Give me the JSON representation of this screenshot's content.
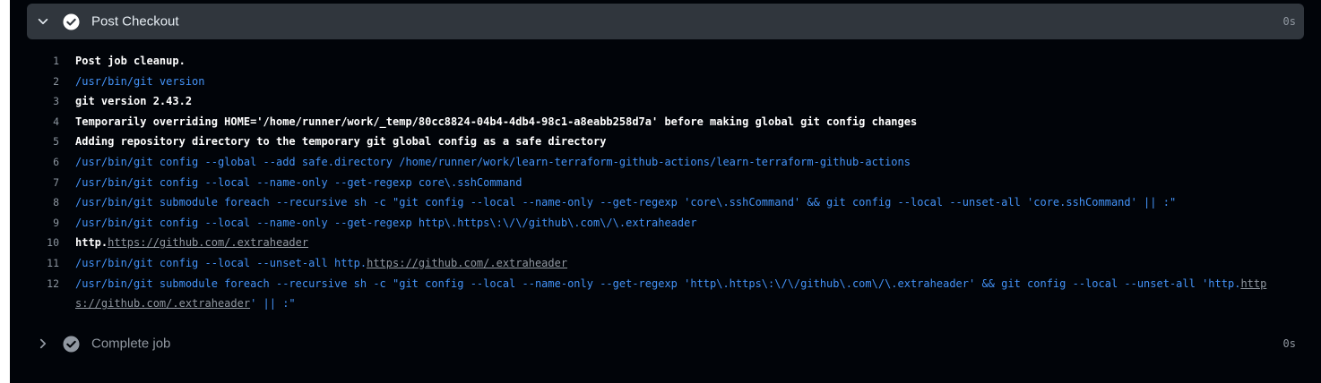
{
  "steps": [
    {
      "title": "Post Checkout",
      "duration": "0s",
      "expanded": true,
      "chevron_icon": "chevron-down-icon",
      "status_icon": "check-circle-icon",
      "lines": [
        {
          "num": "1",
          "kind": "out",
          "parts": [
            {
              "t": "Post job cleanup."
            }
          ]
        },
        {
          "num": "2",
          "kind": "cmd",
          "parts": [
            {
              "t": "/usr/bin/git version"
            }
          ]
        },
        {
          "num": "3",
          "kind": "out",
          "parts": [
            {
              "t": "git version 2.43.2"
            }
          ]
        },
        {
          "num": "4",
          "kind": "out",
          "parts": [
            {
              "t": "Temporarily overriding HOME='/home/runner/work/_temp/80cc8824-04b4-4db4-98c1-a8eabb258d7a' before making global git config changes"
            }
          ]
        },
        {
          "num": "5",
          "kind": "out",
          "parts": [
            {
              "t": "Adding repository directory to the temporary git global config as a safe directory"
            }
          ]
        },
        {
          "num": "6",
          "kind": "cmd",
          "parts": [
            {
              "t": "/usr/bin/git config --global --add safe.directory /home/runner/work/learn-terraform-github-actions/learn-terraform-github-actions"
            }
          ]
        },
        {
          "num": "7",
          "kind": "cmd",
          "parts": [
            {
              "t": "/usr/bin/git config --local --name-only --get-regexp core\\.sshCommand"
            }
          ]
        },
        {
          "num": "8",
          "kind": "cmd",
          "parts": [
            {
              "t": "/usr/bin/git submodule foreach --recursive sh -c \"git config --local --name-only --get-regexp 'core\\.sshCommand' && git config --local --unset-all 'core.sshCommand' || :\""
            }
          ]
        },
        {
          "num": "9",
          "kind": "cmd",
          "parts": [
            {
              "t": "/usr/bin/git config --local --name-only --get-regexp http\\.https\\:\\/\\/github\\.com\\/\\.extraheader"
            }
          ]
        },
        {
          "num": "10",
          "kind": "out",
          "parts": [
            {
              "t": "http."
            },
            {
              "t": "https://github.com/.extraheader",
              "link": true
            }
          ]
        },
        {
          "num": "11",
          "kind": "cmd",
          "parts": [
            {
              "t": "/usr/bin/git config --local --unset-all http."
            },
            {
              "t": "https://github.com/.extraheader",
              "link": true
            }
          ]
        },
        {
          "num": "12",
          "kind": "cmd",
          "parts": [
            {
              "t": "/usr/bin/git submodule foreach --recursive sh -c \"git config --local --name-only --get-regexp 'http\\.https\\:\\/\\/github\\.com\\/\\.extraheader' && git config --local --unset-all 'http."
            },
            {
              "t": "https://github.com/.extraheader",
              "link": true
            },
            {
              "t": "' || :\""
            }
          ]
        }
      ]
    },
    {
      "title": "Complete job",
      "duration": "0s",
      "expanded": false,
      "chevron_icon": "chevron-right-icon",
      "status_icon": "check-circle-icon"
    }
  ],
  "colors": {
    "background": "#010409",
    "header_bg": "#30363d",
    "command": "#4493f8",
    "output": "#ffffff",
    "muted": "#9198a1",
    "check_expanded": "#ffffff",
    "check_collapsed": "#9198a1"
  }
}
